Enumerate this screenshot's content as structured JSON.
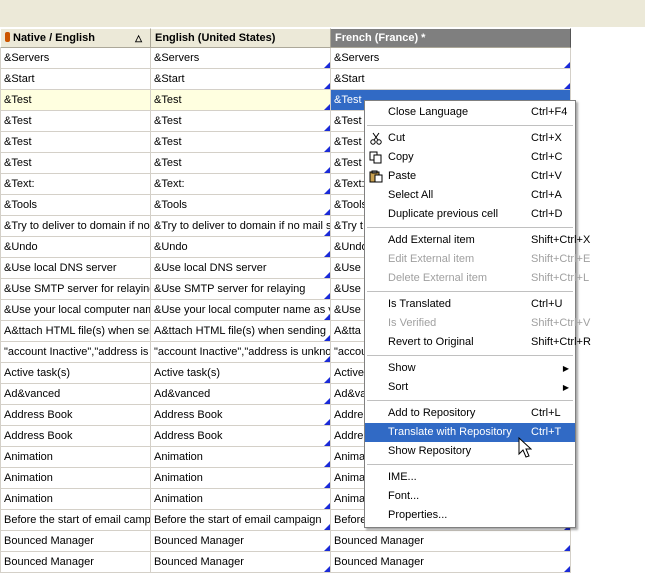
{
  "headers": [
    "Native / English",
    "English (United States)",
    "French (France) *"
  ],
  "rows": [
    [
      "&Servers",
      "&Servers",
      "&Servers"
    ],
    [
      "&Start",
      "&Start",
      "&Start"
    ],
    [
      "&Test",
      "&Test",
      "&Test"
    ],
    [
      "&Test",
      "&Test",
      "&Test"
    ],
    [
      "&Test",
      "&Test",
      "&Test"
    ],
    [
      "&Test",
      "&Test",
      "&Test"
    ],
    [
      "&Text:",
      "&Text:",
      "&Text:"
    ],
    [
      "&Tools",
      "&Tools",
      "&Tools"
    ],
    [
      "&Try to deliver to domain if no mail server",
      "&Try to deliver to domain if no mail server",
      "&Try t"
    ],
    [
      "&Undo",
      "&Undo",
      "&Undo"
    ],
    [
      "&Use local DNS server",
      "&Use local DNS server",
      "&Use"
    ],
    [
      "&Use SMTP server for relaying",
      "&Use SMTP server for relaying",
      "&Use"
    ],
    [
      "&Use your local computer name",
      "&Use your local computer name as your",
      "&Use"
    ],
    [
      "A&ttach HTML file(s) when sending",
      "A&ttach HTML file(s) when sending",
      "A&tta"
    ],
    [
      "\"account Inactive\",\"address is unknown\"",
      "\"account Inactive\",\"address is unknown\"",
      "\"accou"
    ],
    [
      "Active task(s)",
      "Active task(s)",
      "Active"
    ],
    [
      "Ad&vanced",
      "Ad&vanced",
      "Ad&va"
    ],
    [
      "Address Book",
      "Address Book",
      "Addre"
    ],
    [
      "Address Book",
      "Address Book",
      "Addre"
    ],
    [
      "Animation",
      "Animation",
      "Anima"
    ],
    [
      "Animation",
      "Animation",
      "Anima"
    ],
    [
      "Animation",
      "Animation",
      "Anima"
    ],
    [
      "Before the start of email campaign",
      "Before the start of email campaign",
      "Before"
    ],
    [
      "Bounced Manager",
      "Bounced Manager",
      "Bounced Manager"
    ],
    [
      "Bounced Manager",
      "Bounced Manager",
      "Bounced Manager"
    ]
  ],
  "context_menu": {
    "items": [
      {
        "label": "Close Language",
        "shortcut": "Ctrl+F4"
      },
      {
        "sep": true
      },
      {
        "label": "Cut",
        "shortcut": "Ctrl+X",
        "icon": "scissors-icon"
      },
      {
        "label": "Copy",
        "shortcut": "Ctrl+C",
        "icon": "copy-icon"
      },
      {
        "label": "Paste",
        "shortcut": "Ctrl+V",
        "icon": "paste-icon"
      },
      {
        "label": "Select All",
        "shortcut": "Ctrl+A"
      },
      {
        "label": "Duplicate previous cell",
        "shortcut": "Ctrl+D"
      },
      {
        "sep": true
      },
      {
        "label": "Add External item",
        "shortcut": "Shift+Ctrl+X"
      },
      {
        "label": "Edit External item",
        "shortcut": "Shift+Ctrl+E",
        "disabled": true
      },
      {
        "label": "Delete External item",
        "shortcut": "Shift+Ctrl+L",
        "disabled": true
      },
      {
        "sep": true
      },
      {
        "label": "Is Translated",
        "shortcut": "Ctrl+U"
      },
      {
        "label": "Is Verified",
        "shortcut": "Shift+Ctrl+V",
        "disabled": true
      },
      {
        "label": "Revert to Original",
        "shortcut": "Shift+Ctrl+R"
      },
      {
        "sep": true
      },
      {
        "label": "Show",
        "submenu": true
      },
      {
        "label": "Sort",
        "submenu": true
      },
      {
        "sep": true
      },
      {
        "label": "Add to Repository",
        "shortcut": "Ctrl+L"
      },
      {
        "label": "Translate with Repository",
        "shortcut": "Ctrl+T",
        "highlighted": true
      },
      {
        "label": "Show Repository"
      },
      {
        "sep": true
      },
      {
        "label": "IME..."
      },
      {
        "label": "Font..."
      },
      {
        "label": "Properties..."
      }
    ]
  },
  "colors": {
    "accent": "#316ac5",
    "translated_mark": "#1a2bd8"
  }
}
